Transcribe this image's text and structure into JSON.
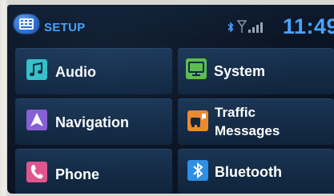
{
  "header": {
    "title": "SETUP",
    "time": "11:49"
  },
  "menu": {
    "audio": {
      "label": "Audio",
      "icon": "note-icon",
      "color": "#36c4c9"
    },
    "system": {
      "label": "System",
      "icon": "monitor-icon",
      "color": "#5ec04a"
    },
    "navigation": {
      "label": "Navigation",
      "icon": "navigation-arrow-icon",
      "color": "#8a5fd6"
    },
    "traffic": {
      "label_line1": "Traffic",
      "label_line2": "Messages",
      "icon": "traffic-icon",
      "color": "#f08a2c"
    },
    "phone": {
      "label": "Phone",
      "icon": "phone-icon",
      "color": "#e0558e"
    },
    "bluetooth": {
      "label": "Bluetooth",
      "icon": "bluetooth-icon",
      "color": "#2d8fe6"
    }
  }
}
